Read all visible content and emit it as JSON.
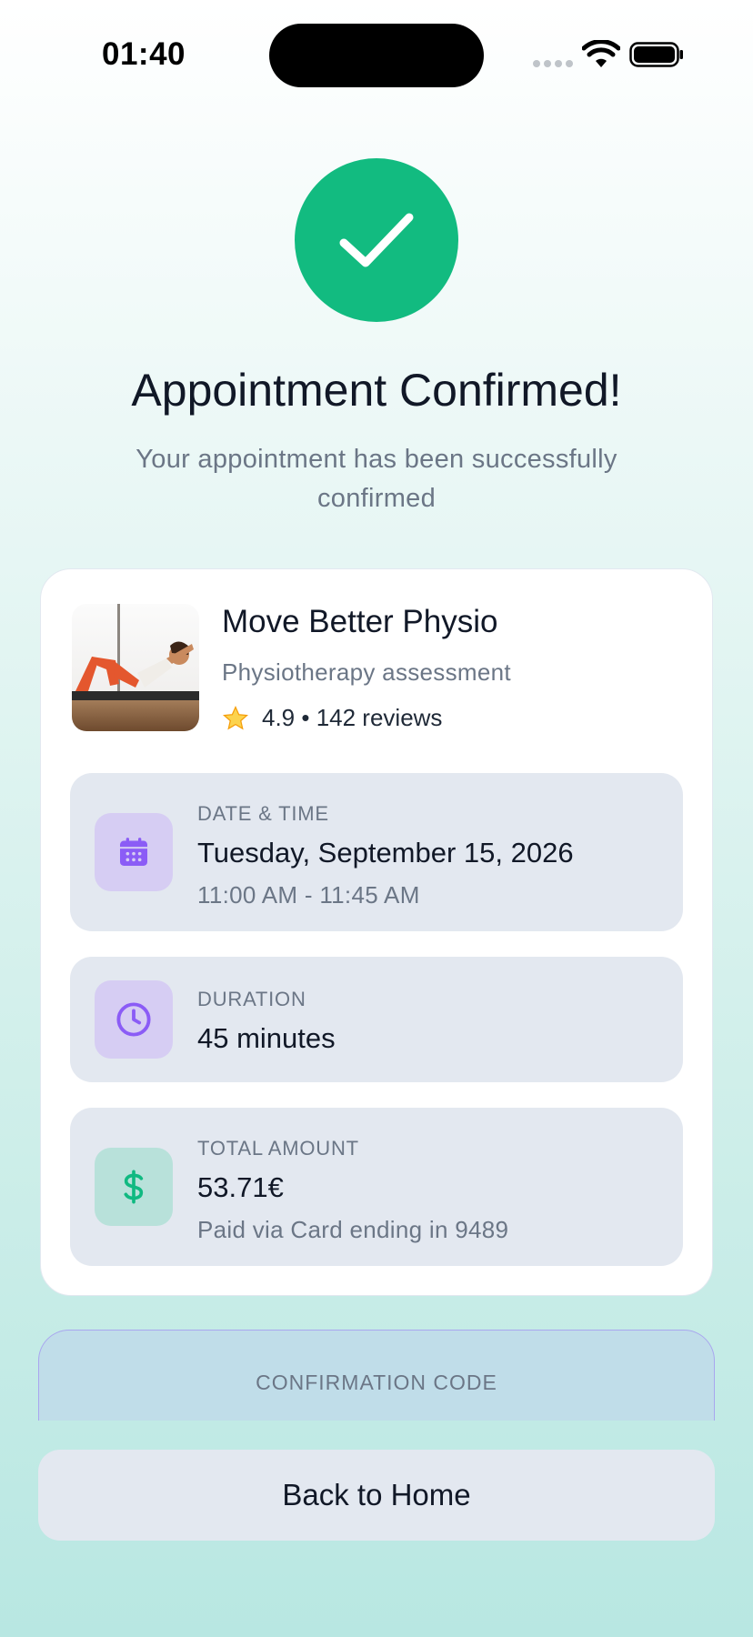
{
  "status_bar": {
    "time": "01:40"
  },
  "header": {
    "title": "Appointment Confirmed!",
    "subtitle": "Your appointment has been successfully confirmed"
  },
  "clinic": {
    "name": "Move Better Physio",
    "service": "Physiotherapy assessment",
    "rating_text": "4.9 • 142 reviews"
  },
  "details": {
    "date_time": {
      "label": "DATE & TIME",
      "value": "Tuesday, September 15, 2026",
      "sub": "11:00 AM - 11:45 AM"
    },
    "duration": {
      "label": "DURATION",
      "value": "45 minutes"
    },
    "amount": {
      "label": "TOTAL AMOUNT",
      "value": "53.71€",
      "sub": "Paid via Card ending in 9489"
    }
  },
  "confirmation": {
    "label": "CONFIRMATION CODE"
  },
  "actions": {
    "back_home": "Back to Home"
  },
  "colors": {
    "success": "#12bb80",
    "accent_purple": "#8b5cf6",
    "accent_green": "#10b981"
  },
  "icons": [
    "wifi-icon",
    "battery-icon",
    "checkmark-icon",
    "star-icon",
    "calendar-icon",
    "clock-icon",
    "dollar-icon"
  ]
}
